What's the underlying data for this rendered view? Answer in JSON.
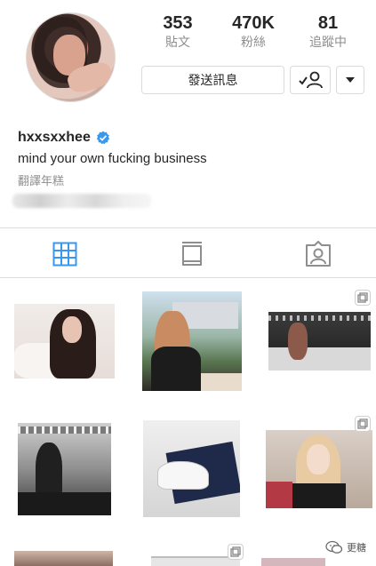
{
  "profile": {
    "username": "hxxsxxhee",
    "bio": "mind your own fucking business",
    "translate_label": "翻譯年糕",
    "verified": true
  },
  "stats": [
    {
      "value": "353",
      "label": "貼文"
    },
    {
      "value": "470K",
      "label": "粉絲"
    },
    {
      "value": "81",
      "label": "追蹤中"
    }
  ],
  "actions": {
    "message_label": "發送訊息"
  },
  "tabs": [
    {
      "icon": "grid-icon",
      "active": true
    },
    {
      "icon": "igtv-icon",
      "active": false
    },
    {
      "icon": "tagged-icon",
      "active": false
    }
  ],
  "colors": {
    "accent": "#3897f0",
    "text": "#262626",
    "muted": "#8e8e8e",
    "border": "#dbdbdb"
  },
  "watermark": {
    "text": "更糖"
  }
}
